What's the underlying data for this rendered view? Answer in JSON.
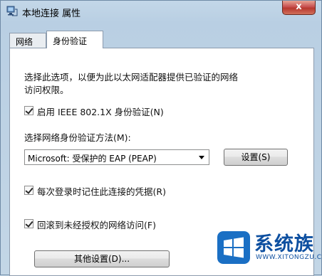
{
  "window": {
    "title": "本地连接 属性",
    "close_label": "x"
  },
  "tabs": [
    {
      "label": "网络",
      "active": false
    },
    {
      "label": "身份验证",
      "active": true
    }
  ],
  "panel": {
    "description_line1": "选择此选项，以便为此以太网适配器提供已验证的网络",
    "description_line2": "访问权限。",
    "enable_8021x": {
      "label": "启用 IEEE 802.1X 身份验证(N)",
      "checked": true
    },
    "method_label": "选择网络身份验证方法(M):",
    "method_select": {
      "value": "Microsoft: 受保护的 EAP (PEAP)"
    },
    "settings_button": "设置(S)",
    "remember_credentials": {
      "label": "每次登录时记住此连接的凭据(R)",
      "checked": true
    },
    "fallback_unauthorized": {
      "label": "回滚到未经授权的网络访问(F)",
      "checked": true
    },
    "other_settings_button": "其他设置(D)..."
  },
  "watermark": {
    "title": "系统族",
    "url": "WWW.XITONGZU.COM",
    "logo_color": "#1a6fc4",
    "text_color": "#0d4fa0"
  }
}
